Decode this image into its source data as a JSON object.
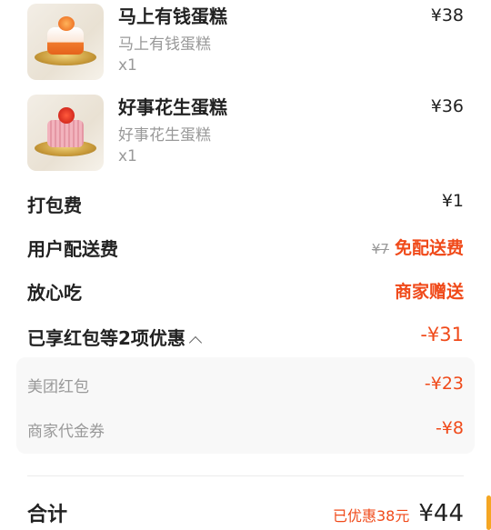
{
  "items": [
    {
      "name": "马上有钱蛋糕",
      "sub": "马上有钱蛋糕",
      "qty": "x1",
      "price": "¥38"
    },
    {
      "name": "好事花生蛋糕",
      "sub": "好事花生蛋糕",
      "qty": "x1",
      "price": "¥36"
    }
  ],
  "fees": {
    "packing": {
      "label": "打包费",
      "value": "¥1"
    },
    "delivery": {
      "label": "用户配送费",
      "original": "¥7",
      "value": "免配送费"
    },
    "assurance": {
      "label": "放心吃",
      "value": "商家赠送"
    }
  },
  "discount": {
    "label": "已享红包等2项优惠",
    "value": "-¥31",
    "details": [
      {
        "label": "美团红包",
        "value": "-¥23"
      },
      {
        "label": "商家代金券",
        "value": "-¥8"
      }
    ]
  },
  "total": {
    "label": "合计",
    "saved": "已优惠38元",
    "value": "¥44"
  },
  "colors": {
    "accent": "#f04a1a",
    "muted": "#999999",
    "scroll": "#f5a623"
  }
}
